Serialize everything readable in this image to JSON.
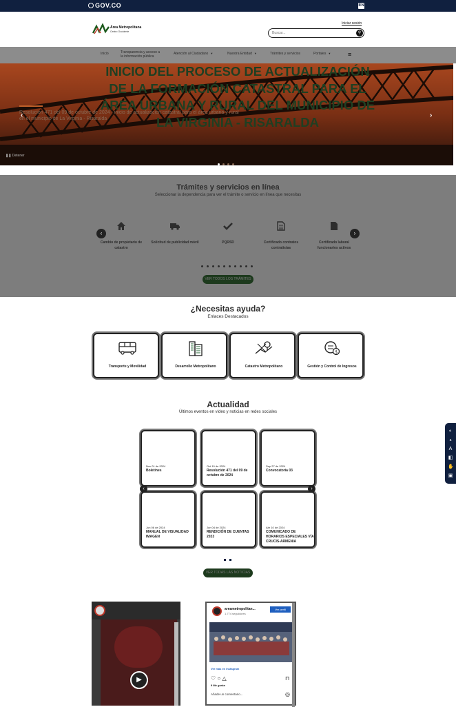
{
  "topbar": {
    "gov_logo": "GOV.CO",
    "lang_label": "EN"
  },
  "header": {
    "logo_title": "Área Metropolitana",
    "logo_subtitle": "Centro Occidente",
    "login_link": "Iniciar sesión",
    "search_placeholder": "Buscar..."
  },
  "nav": {
    "items": [
      {
        "label": "Inicio",
        "caret": false
      },
      {
        "label": "Transparencia y acceso a la información pública",
        "caret": false
      },
      {
        "label": "Atención al Ciudadano",
        "caret": true
      },
      {
        "label": "Nuestra Entidad",
        "caret": true
      },
      {
        "label": "Trámites y servicios",
        "caret": false
      },
      {
        "label": "Portales",
        "caret": true
      }
    ]
  },
  "hero": {
    "title": "INICIO DEL PROCESO DE ACTUALIZACIÓN DE LA FORMACIÓN CATASTRAL PARA EL ÁREA URBANA Y RURAL DEL MUNICIPIO DE LA VIRGINIA - RISARALDA",
    "caption": "Resolución 471 del 09 de octubre de 2024 - inicio de actualización catastral para el área urbana y rural en el municipio de La Virginia - Risaralda",
    "pause_label": "Detener",
    "prev": "‹",
    "next": "›",
    "dot_count": 4
  },
  "tramites": {
    "title": "Trámites y servicios en línea",
    "subtitle": "Seleccionar la dependencia para ver el trámite o servicio en línea que necesitas",
    "items": [
      {
        "icon": "home-icon",
        "glyph": "🏠",
        "label": "Cambio de propietario de catastro"
      },
      {
        "icon": "truck-icon",
        "glyph": "🚚",
        "label": "Solicitud de publicidad móvil"
      },
      {
        "icon": "check-icon",
        "glyph": "✔",
        "label": "PQRSD"
      },
      {
        "icon": "document-icon",
        "glyph": "📄",
        "label": "Certificado contratos contratistas"
      },
      {
        "icon": "file-icon",
        "glyph": "📃",
        "label": "Certificado laboral funcionarios activos"
      }
    ],
    "dot_count": 10,
    "button": "VER TODOS LOS TRÁMITES"
  },
  "help": {
    "title": "¿Necesitas ayuda?",
    "subtitle": "Enlaces Destacados",
    "cards": [
      {
        "icon": "bus-icon",
        "label": "Transporte y Movilidad"
      },
      {
        "icon": "buildings-icon",
        "label": "Desarrollo Metropolitano"
      },
      {
        "icon": "map-compass-icon",
        "label": "Catastro Metropolitano"
      },
      {
        "icon": "income-gear-icon",
        "label": "Gestión y Control de Ingresos"
      }
    ]
  },
  "news": {
    "title": "Actualidad",
    "subtitle": "Últimos eventos en video y noticias en redes sociales",
    "items": [
      {
        "date": "Nov 01 de 2024",
        "title": "Boletines"
      },
      {
        "date": "Oct 10 de 2024",
        "title": "Resolución 471 del 09 de octubre de 2024"
      },
      {
        "date": "Sep 27 de 2024",
        "title": "Convocatoria 03"
      },
      {
        "date": "Jun 06 de 2024",
        "title": "MANUAL DE VISUALIDAD IMAGEN"
      },
      {
        "date": "Jun 04 de 2024",
        "title": "RENDICIÓN DE CUENTAS 2023"
      },
      {
        "date": "Abr 10 de 2024",
        "title": "COMUNICADO DE HORARIOS ESPECIALES VÍA CRUCIS-ARMENIA"
      }
    ],
    "dot_count": 2,
    "button": "VER TODAS LAS NOTICIAS"
  },
  "social": {
    "ig_user": "areametropolitan...",
    "ig_followers": "1.774 seguidores",
    "ig_profile_btn": "Ver perfil",
    "ig_more": "Ver más en Instagram",
    "ig_likes": "9 Me gusta",
    "ig_comment": "Añade un comentario..."
  },
  "colors": {
    "dark_navy": "#10203f",
    "dark_green": "#1d3a1d",
    "gray_band": "#7d7d7d"
  }
}
